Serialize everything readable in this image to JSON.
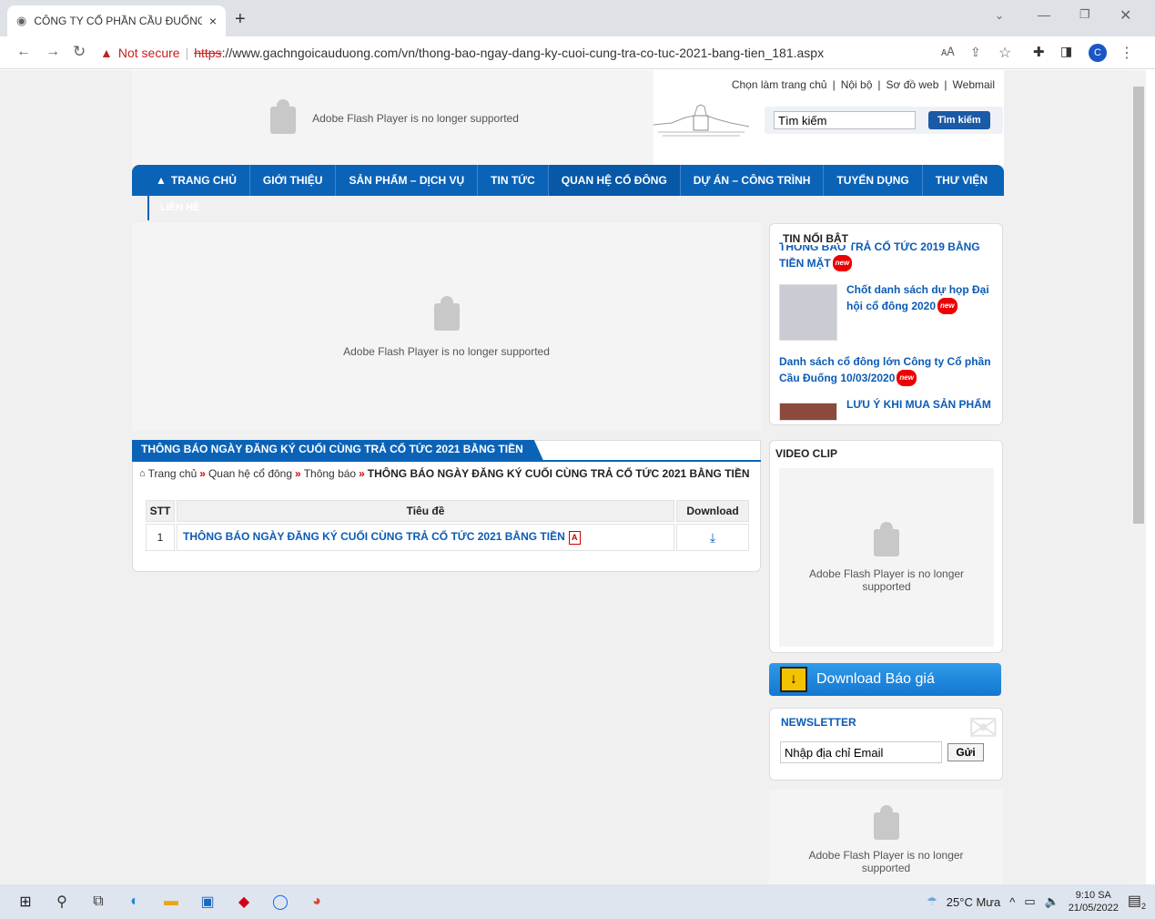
{
  "browser": {
    "tab_title": "CÔNG TY CỔ PHẦN CẦU ĐUỐNG",
    "close_glyph": "×",
    "new_tab_glyph": "+",
    "security_label": "Not secure",
    "url_scheme": "https",
    "url_rest": "://www.gachngoicauduong.com/vn/thong-bao-ngay-dang-ky-cuoi-cung-tra-co-tuc-2021-bang-tien_181.aspx",
    "profile_initial": "C"
  },
  "header": {
    "flash_message": "Adobe Flash Player is no longer supported",
    "top_links": [
      "Chọn làm trang chủ",
      "Nội bộ",
      "Sơ đồ web",
      "Webmail"
    ],
    "search_value": "Tìm kiếm",
    "search_button": "Tìm kiếm"
  },
  "nav": {
    "items": [
      "TRANG CHỦ",
      "GIỚI THIỆU",
      "SẢN PHẨM – DỊCH VỤ",
      "TIN TỨC",
      "QUAN HỆ CỔ ĐÔNG",
      "DỰ ÁN – CÔNG TRÌNH",
      "TUYỂN DỤNG",
      "THƯ VIỆN"
    ],
    "sub_item": "LIÊN HỆ"
  },
  "main_flash": "Adobe Flash Player is no longer supported",
  "content": {
    "tab_title": "THÔNG BÁO NGÀY ĐĂNG KÝ CUỐI CÙNG TRẢ CỔ TỨC 2021 BẰNG TIỀN",
    "breadcrumb": [
      "Trang chủ",
      "Quan hệ cổ đông",
      "Thông báo"
    ],
    "breadcrumb_sep": "»",
    "breadcrumb_current": "THÔNG BÁO NGÀY ĐĂNG KÝ CUỐI CÙNG TRẢ CỔ TỨC 2021 BẰNG TIỀN",
    "table": {
      "headers": [
        "STT",
        "Tiêu đề",
        "Download"
      ],
      "rows": [
        {
          "stt": "1",
          "title": "THÔNG BÁO NGÀY ĐĂNG KÝ CUỐI CÙNG TRẢ CỔ TỨC 2021 BẰNG TIỀN"
        }
      ]
    }
  },
  "sidebar": {
    "tin_title": "TIN NỔI BẬT",
    "tin_items": [
      {
        "title": "THÔNG BÁO TRẢ CỔ TỨC 2019 BẰNG TIỀN MẶT"
      },
      {
        "title": "Chốt danh sách dự họp Đại hội cổ đông 2020"
      },
      {
        "title": "Danh sách cổ đông lớn Công ty Cổ phần Cầu Đuống 10/03/2020"
      },
      {
        "title": "LƯU Ý KHI MUA SẢN PHẨM"
      }
    ],
    "new_badge": "new",
    "video_title": "VIDEO CLIP",
    "video_flash": "Adobe Flash Player is no longer supported",
    "download_label": "Download Báo giá",
    "newsletter_title": "NEWSLETTER",
    "newsletter_value": "Nhập địa chỉ Email",
    "newsletter_button": "Gửi",
    "bottom_flash": "Adobe Flash Player is no longer supported"
  },
  "taskbar": {
    "weather": "25°C  Mưa",
    "time": "9:10 SA",
    "date": "21/05/2022",
    "notif_count": "2"
  },
  "colors": {
    "nav_blue": "#0b63b8",
    "link_blue": "#0b5bb5",
    "new_badge": "#ee0000"
  }
}
